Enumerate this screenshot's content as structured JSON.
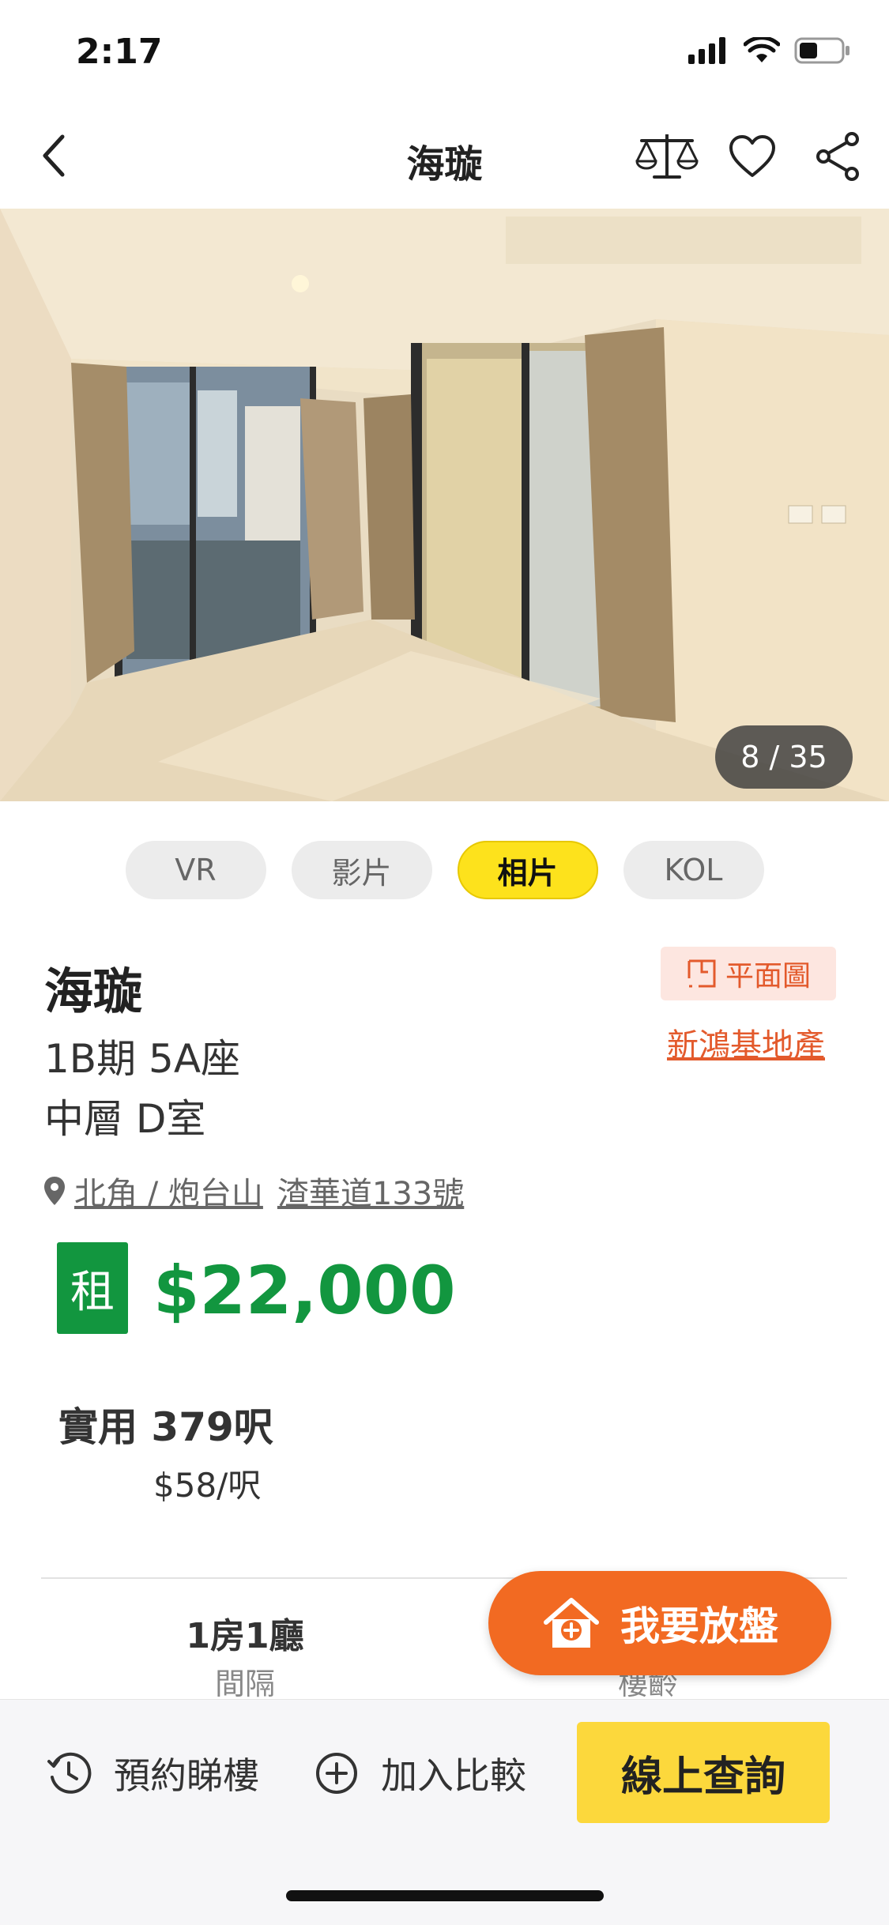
{
  "status_bar": {
    "time": "2:17"
  },
  "nav": {
    "title": "海璇"
  },
  "photo": {
    "counter": "8 / 35"
  },
  "media_tabs": [
    {
      "label": "VR",
      "active": false
    },
    {
      "label": "影片",
      "active": false
    },
    {
      "label": "相片",
      "active": true
    },
    {
      "label": "KOL",
      "active": false
    }
  ],
  "listing": {
    "name": "海璇",
    "phase": "1B期 5A座",
    "unit": "中層 D室",
    "floorplan_label": "平面圖",
    "developer": "新鴻基地產",
    "district": "北角 / 炮台山",
    "street": "渣華道133號",
    "rent_badge": "租",
    "price": "$22,000",
    "area": "實用 379呎",
    "unit_price": "$58/呎"
  },
  "stats": {
    "layout_value": "1房1廳",
    "layout_label": "間隔",
    "age_label": "樓齡"
  },
  "fab": {
    "label": "我要放盤"
  },
  "bottom_bar": {
    "schedule": "預約睇樓",
    "compare": "加入比較",
    "cta": "線上查詢"
  },
  "colors": {
    "accent_green": "#12963f",
    "accent_orange": "#f26a22",
    "tab_yellow": "#fde21c",
    "cta_yellow": "#fcd83c"
  }
}
